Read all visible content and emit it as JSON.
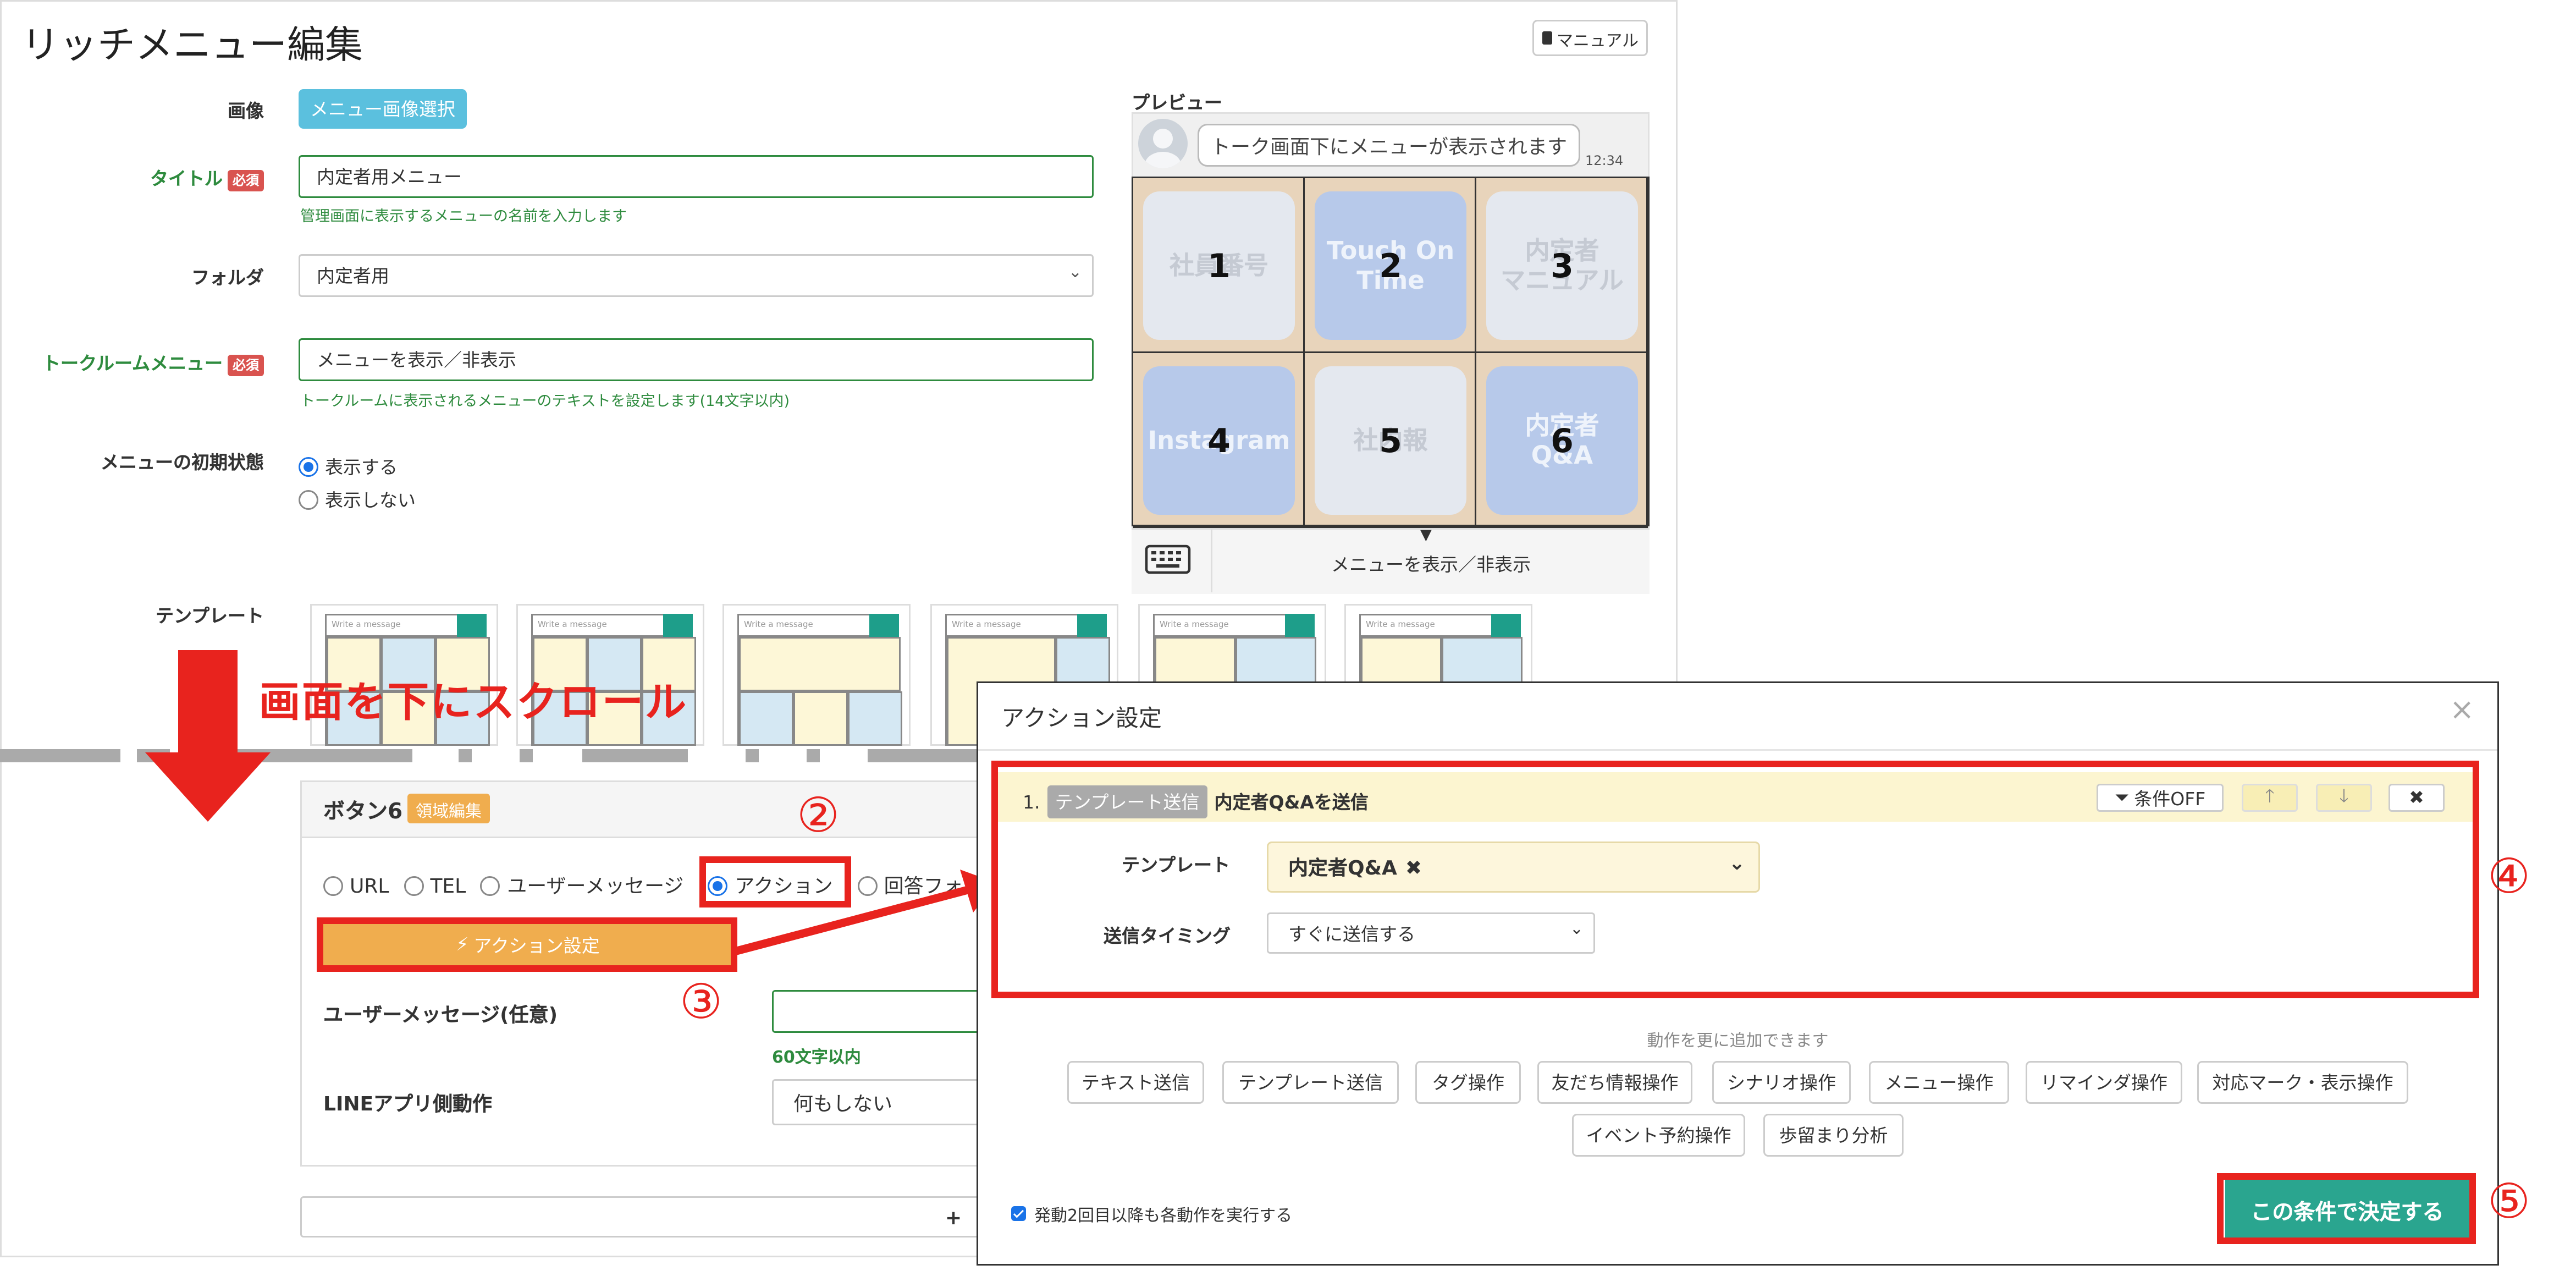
{
  "page": {
    "title": "リッチメニュー編集",
    "manual_label": "マニュアル",
    "image_label": "画像",
    "image_button": "メニュー画像選択",
    "title_label": "タイトル",
    "required": "必須",
    "title_value": "内定者用メニュー",
    "title_help": "管理画面に表示するメニューの名前を入力します",
    "folder_label": "フォルダ",
    "folder_value": "内定者用",
    "talkroom_label": "トークルームメニュー",
    "talkroom_value": "メニューを表示／非表示",
    "talkroom_help": "トークルームに表示されるメニューのテキストを設定します(14文字以内)",
    "initial_label": "メニューの初期状態",
    "initial_options": [
      "表示する",
      "表示しない"
    ],
    "template_label": "テンプレート",
    "template_thumb_text": "Write a message"
  },
  "preview": {
    "label": "プレビュー",
    "bubble": "トーク画面下にメニューが表示されます",
    "time": "12:34",
    "cells": [
      {
        "num": "1",
        "text": "社員番号",
        "style": "light"
      },
      {
        "num": "2",
        "text": "Touch On Time",
        "style": "blue"
      },
      {
        "num": "3",
        "text": "内定者\nマニュアル",
        "style": "light"
      },
      {
        "num": "4",
        "text": "Instagram",
        "style": "blue"
      },
      {
        "num": "5",
        "text": "社内報",
        "style": "light"
      },
      {
        "num": "6",
        "text": "内定者\nQ&A",
        "style": "blue"
      }
    ],
    "menu_toggle": "メニューを表示／非表示"
  },
  "annotation": {
    "scroll_text": "画面を下にスクロール",
    "step2": "②",
    "step3": "③",
    "step4": "④",
    "step5": "⑤"
  },
  "button_panel": {
    "title": "ボタン6",
    "area_edit": "領域編集",
    "types": [
      "URL",
      "TEL",
      "ユーザーメッセージ",
      "アクション",
      "回答フォ"
    ],
    "selected_type": "アクション",
    "action_button": "アクション設定",
    "user_msg_label": "ユーザーメッセージ(任意)",
    "user_msg_help": "60文字以内",
    "line_label": "LINEアプリ側動作",
    "line_value": "何もしない"
  },
  "modal": {
    "title": "アクション設定",
    "close": "×",
    "row_index": "1.",
    "row_tag": "テンプレート送信",
    "row_title": "内定者Q&Aを送信",
    "cond_off": "条件OFF",
    "template_label": "テンプレート",
    "template_value": "内定者Q&A",
    "timing_label": "送信タイミング",
    "timing_value": "すぐに送信する",
    "more_text": "動作を更に追加できます",
    "actions_row1": [
      "テキスト送信",
      "テンプレート送信",
      "タグ操作",
      "友だち情報操作",
      "シナリオ操作",
      "メニュー操作",
      "リマインダ操作",
      "対応マーク・表示操作"
    ],
    "actions_row2": [
      "イベント予約操作",
      "歩留まり分析"
    ],
    "checkbox_label": "発動2回目以降も各動作を実行する",
    "confirm_label": "この条件で決定する"
  },
  "colors": {
    "accent_red": "#e8231e",
    "info_blue": "#5bc0de",
    "warning_orange": "#f0ad4e",
    "success_teal": "#2aa58f",
    "label_green": "#2e8b3e"
  }
}
